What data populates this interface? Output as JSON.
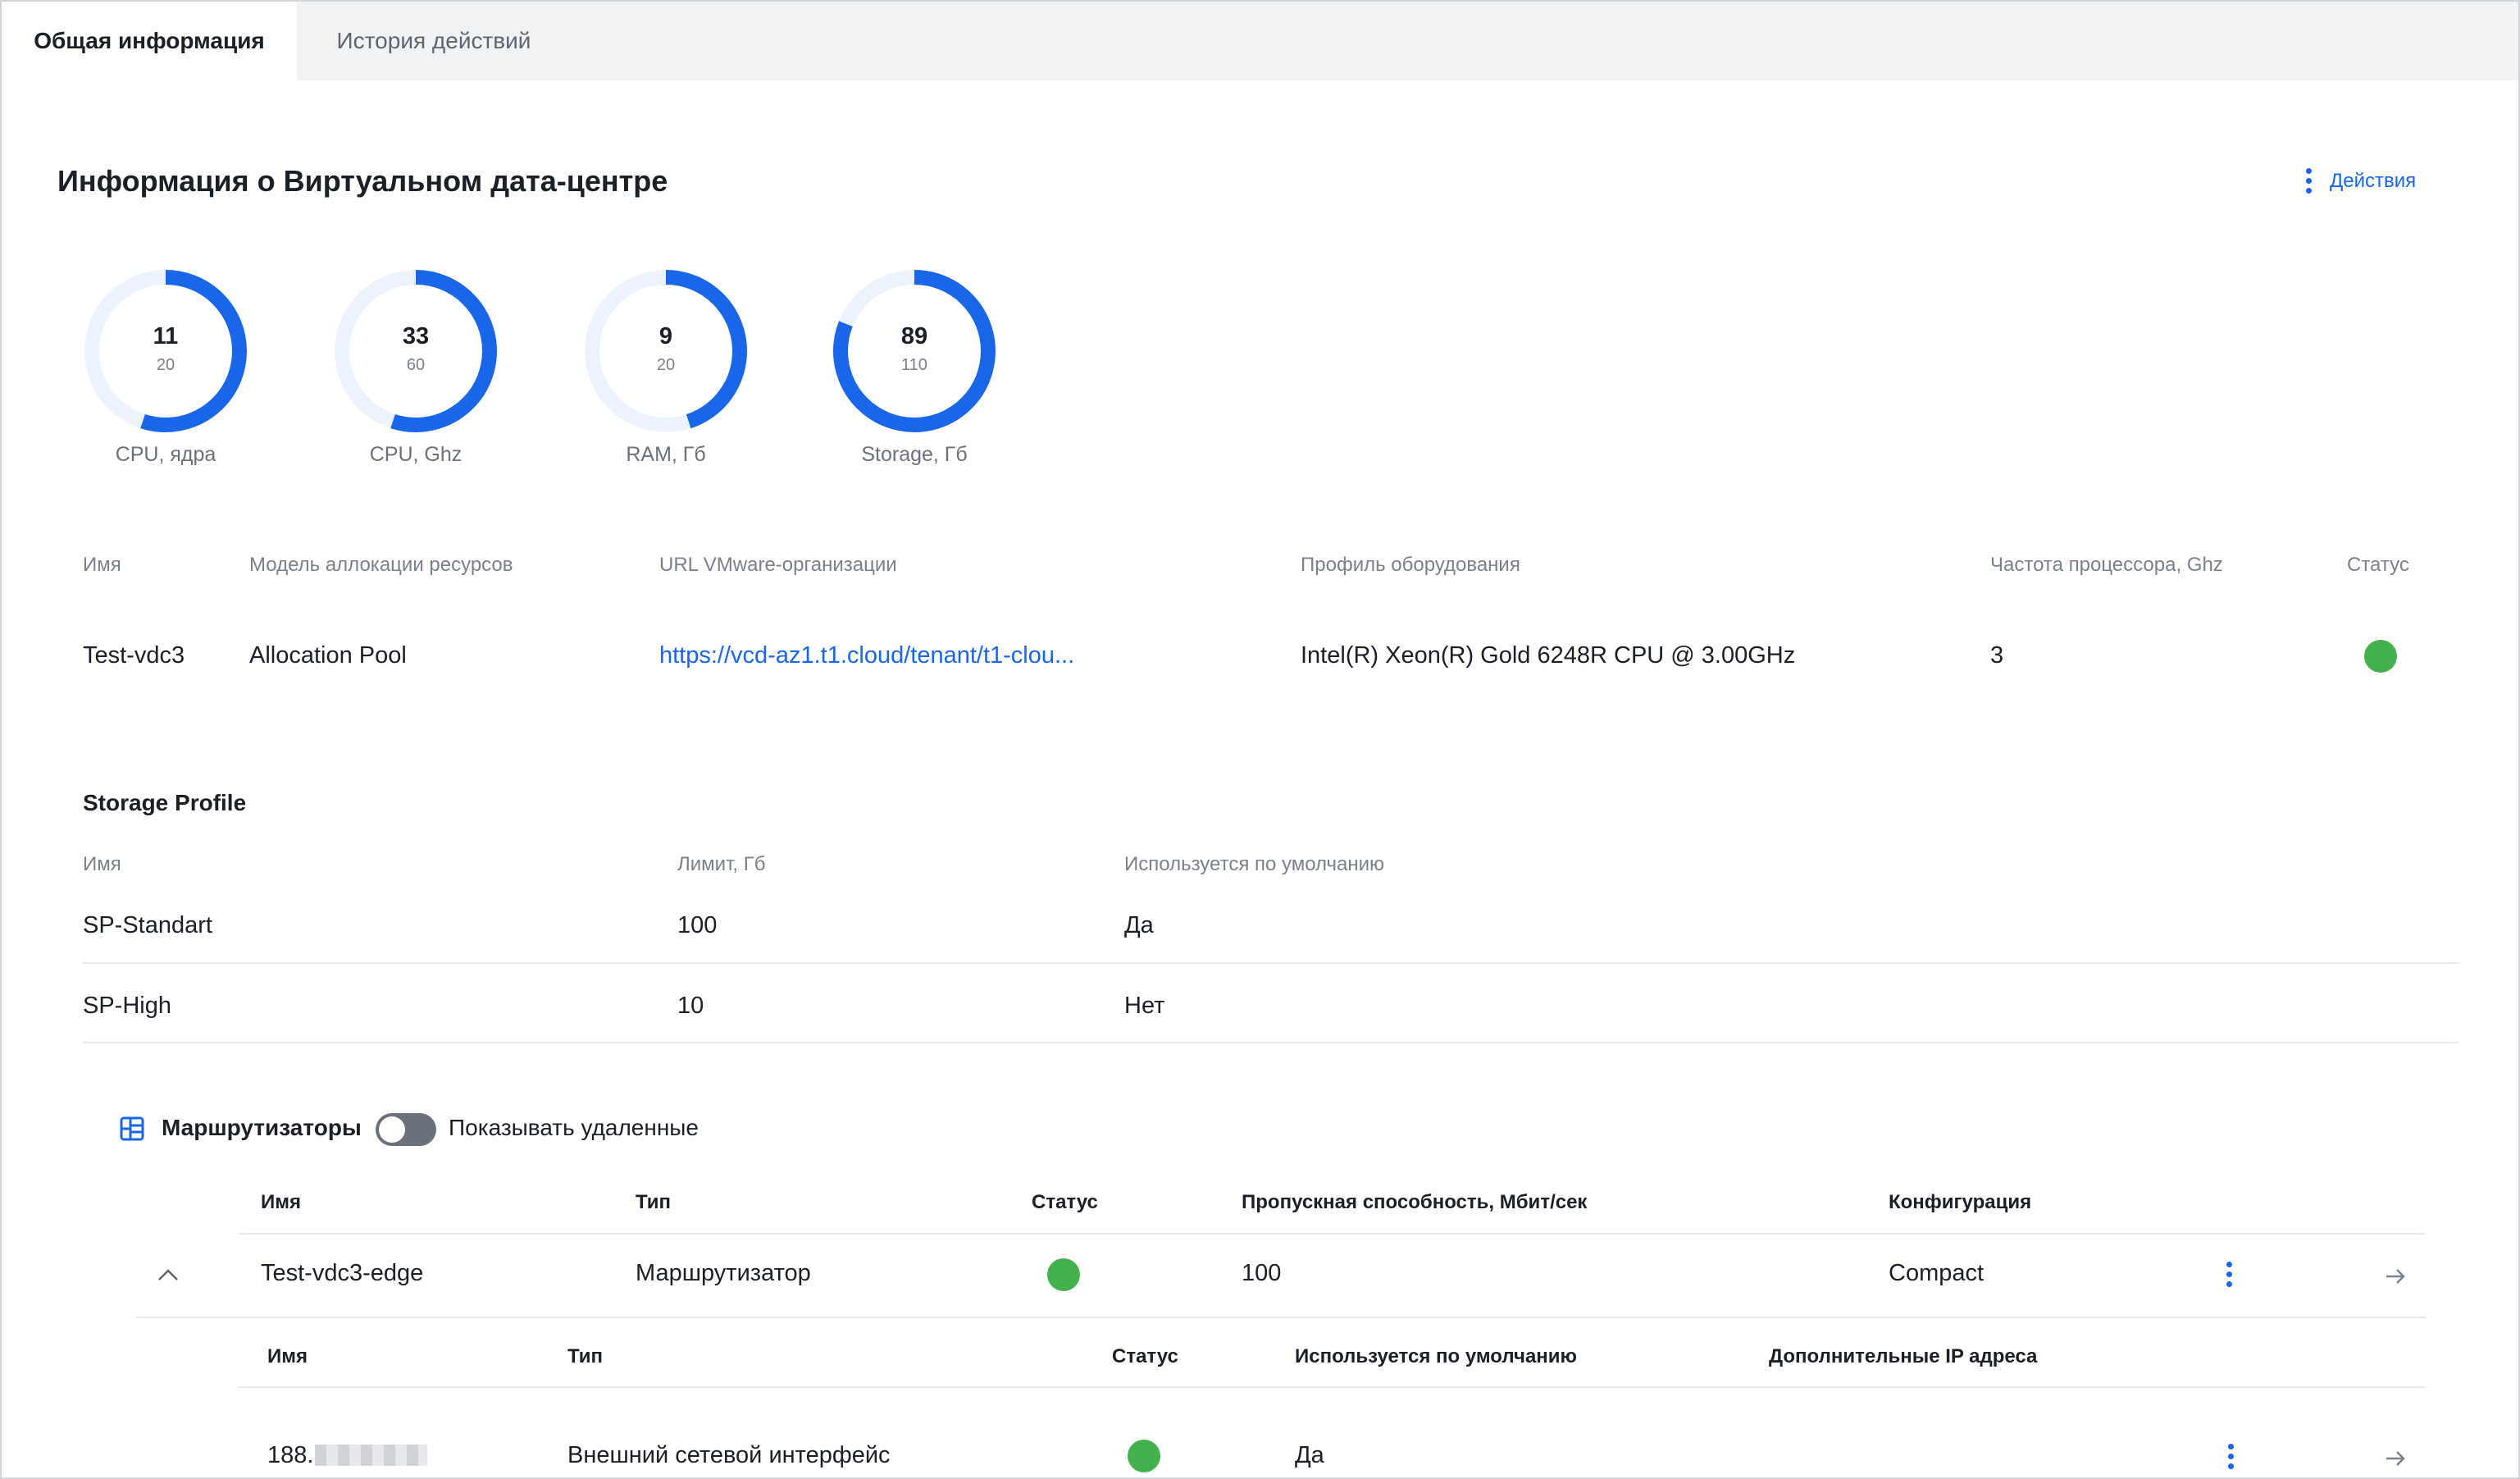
{
  "tabs": [
    {
      "label": "Общая информация"
    },
    {
      "label": "История действий"
    }
  ],
  "page": {
    "title": "Информация о Виртуальном дата-центре",
    "actions_label": "Действия"
  },
  "gauges": [
    {
      "value": "11",
      "max": "20",
      "label": "CPU, ядра",
      "fraction": 0.55
    },
    {
      "value": "33",
      "max": "60",
      "label": "CPU, Ghz",
      "fraction": 0.55
    },
    {
      "value": "9",
      "max": "20",
      "label": "RAM, Гб",
      "fraction": 0.45
    },
    {
      "value": "89",
      "max": "110",
      "label": "Storage, Гб",
      "fraction": 0.81
    }
  ],
  "vdc": {
    "headers": {
      "name": "Имя",
      "allocation": "Модель аллокации ресурсов",
      "url": "URL VMware-организации",
      "profile": "Профиль оборудования",
      "frequency": "Частота процессора, Ghz",
      "status": "Статус"
    },
    "row": {
      "name": "Test-vdc3",
      "allocation": "Allocation Pool",
      "url": "https://vcd-az1.t1.cloud/tenant/t1-clou...",
      "profile": "Intel(R) Xeon(R) Gold 6248R CPU @ 3.00GHz",
      "frequency": "3"
    }
  },
  "storage": {
    "title": "Storage Profile",
    "headers": {
      "name": "Имя",
      "limit": "Лимит, Гб",
      "default": "Используется по умолчанию"
    },
    "rows": [
      {
        "name": "SP-Standart",
        "limit": "100",
        "default": "Да"
      },
      {
        "name": "SP-High",
        "limit": "10",
        "default": "Нет"
      }
    ]
  },
  "routers": {
    "title": "Маршрутизаторы",
    "toggle_label": "Показывать удаленные",
    "headers": {
      "name": "Имя",
      "type": "Тип",
      "status": "Статус",
      "bandwidth": "Пропускная способность, Мбит/сек",
      "config": "Конфигурация"
    },
    "rows": [
      {
        "name": "Test-vdc3-edge",
        "type": "Маршрутизатор",
        "bandwidth": "100",
        "config": "Compact"
      }
    ],
    "interfaces": {
      "headers": {
        "name": "Имя",
        "type": "Тип",
        "status": "Статус",
        "default": "Используется по умолчанию",
        "extra_ip": "Дополнительные IP адреса"
      },
      "rows": [
        {
          "name": "188.",
          "type": "Внешний сетевой интерфейс",
          "default": "Да"
        }
      ]
    }
  },
  "colors": {
    "accent": "#1a66e8",
    "gauge_track": "#edf3fd",
    "status_ok": "#43b14d",
    "tab_bar": "#f1f2f4",
    "muted_text": "#7b818a"
  },
  "icons": [
    "kebab-icon",
    "table-icon",
    "chevron-up-icon",
    "arrow-right-icon"
  ]
}
